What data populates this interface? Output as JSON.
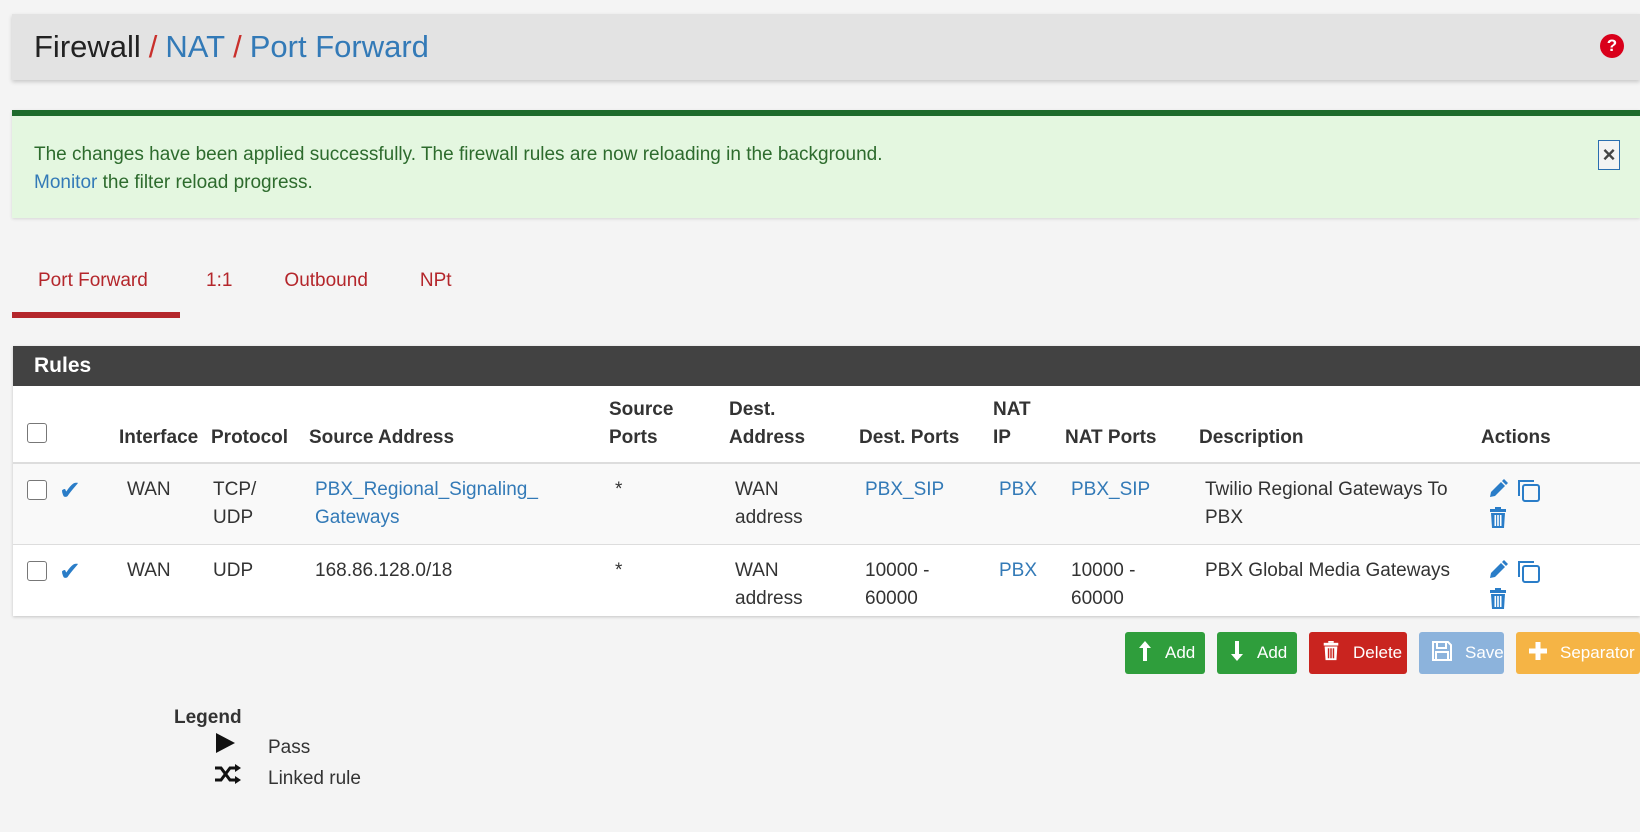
{
  "breadcrumb": {
    "root": "Firewall",
    "sep": "/",
    "nat": "NAT",
    "current": "Port Forward"
  },
  "help": {
    "label": "?"
  },
  "alert": {
    "line1": "The changes have been applied successfully. The firewall rules are now reloading in the background.",
    "link": "Monitor",
    "line2_rest": " the filter reload progress.",
    "close": "×"
  },
  "tabs": [
    {
      "label": "Port Forward"
    },
    {
      "label": "1:1"
    },
    {
      "label": "Outbound"
    },
    {
      "label": "NPt"
    }
  ],
  "panel": {
    "title": "Rules"
  },
  "columns": {
    "interface": "Interface",
    "protocol": "Protocol",
    "source_address": "Source Address",
    "source_ports": "Source Ports",
    "dest_address": "Dest. Address",
    "dest_ports": "Dest. Ports",
    "nat_ip": "NAT IP",
    "nat_ports": "NAT Ports",
    "description": "Description",
    "actions": "Actions"
  },
  "rows": [
    {
      "status_icon": "check-icon",
      "interface": "WAN",
      "protocol": "TCP/ UDP",
      "source_address": "PBX_Regional_Signaling_ Gateways",
      "source_ports": "*",
      "dest_address": "WAN address",
      "dest_ports": "PBX_SIP",
      "nat_ip": "PBX",
      "nat_ports": "PBX_SIP",
      "description": "Twilio Regional Gateways To PBX"
    },
    {
      "status_icon": "check-icon",
      "interface": "WAN",
      "protocol": "UDP",
      "source_address": "168.86.128.0/18",
      "source_ports": "*",
      "dest_address": "WAN address",
      "dest_ports": "10000 - 60000",
      "nat_ip": "PBX",
      "nat_ports": "10000 - 60000",
      "description": "PBX Global Media Gateways"
    }
  ],
  "buttons": {
    "add_top": "Add",
    "add_bottom": "Add",
    "delete": "Delete",
    "save": "Save",
    "separator": "Separator"
  },
  "legend": {
    "title": "Legend",
    "pass": "Pass",
    "linked": "Linked rule"
  },
  "colors": {
    "link": "#337ab7",
    "tab_active": "#b4262b",
    "alert_bg": "#e4f7e0",
    "alert_border": "#1e6b2c",
    "panel_heading": "#424242",
    "btn_green": "#2f9e3c",
    "btn_red": "#c9241f",
    "btn_blue": "#8cb3dc",
    "btn_orange": "#f5b445"
  }
}
